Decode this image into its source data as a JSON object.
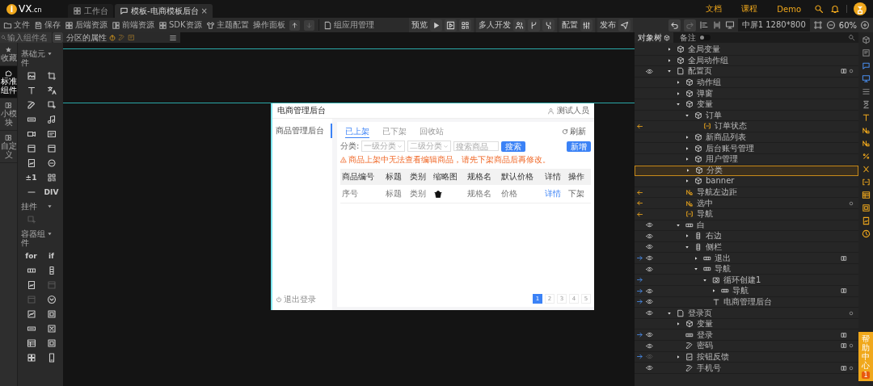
{
  "logo": {
    "badge": "i",
    "name": "VX",
    "domain": ".cn"
  },
  "tabs": [
    {
      "label": "工作台",
      "selected": false
    },
    {
      "label": "模板-电商模板后台",
      "selected": true,
      "close": "×"
    }
  ],
  "links": [
    "文档",
    "课程",
    "Demo"
  ],
  "toolbar": {
    "items": [
      "文件",
      "保存",
      "后端资源",
      "前端资源",
      "SDK资源",
      "主题配置"
    ],
    "panel": "操作面板",
    "apps": "组应用管理"
  },
  "actions": [
    {
      "label": "预览"
    },
    {
      "label": "多人开发"
    },
    {
      "label": "配置"
    },
    {
      "label": "发布"
    }
  ],
  "view": {
    "screen": "中屏1 1280*800",
    "percent": "60%"
  },
  "left": {
    "search": {
      "placeholder": "输入组件名"
    },
    "tabs": [
      {
        "label": "收藏",
        "selected": false
      },
      {
        "label": "标准组件",
        "selected": true
      },
      {
        "label": "小模块",
        "selected": false
      },
      {
        "label": "自定义",
        "selected": false
      }
    ],
    "sections": [
      {
        "title": "基础元件",
        "expanded": true,
        "items": [
          {
            "kind": "image"
          },
          {
            "kind": "crop"
          },
          {
            "kind": "text"
          },
          {
            "kind": "lang"
          },
          {
            "kind": "edit"
          },
          {
            "kind": "frame"
          },
          {
            "kind": "button"
          },
          {
            "kind": "music"
          },
          {
            "kind": "video"
          },
          {
            "kind": "screen"
          },
          {
            "kind": "window"
          },
          {
            "kind": "window"
          },
          {
            "kind": "picture"
          },
          {
            "kind": "bubble"
          },
          {
            "kind": "label",
            "label": "±1"
          },
          {
            "kind": "qr"
          },
          {
            "kind": "line"
          },
          {
            "kind": "label",
            "label": "DIV"
          }
        ]
      },
      {
        "title": "挂件",
        "expanded": true,
        "items": [
          {
            "kind": "frame",
            "disabled": true
          }
        ]
      },
      {
        "title": "容器组件",
        "expanded": true,
        "items": [
          {
            "kind": "label",
            "label": "for",
            "disabled": false
          },
          {
            "kind": "label",
            "label": "if",
            "disabled": false
          },
          {
            "kind": "row",
            "disabled": false
          },
          {
            "kind": "column",
            "disabled": false
          },
          {
            "kind": "picture",
            "disabled": false
          },
          {
            "kind": "window",
            "disabled": true
          },
          {
            "kind": "window",
            "disabled": true
          },
          {
            "kind": "down",
            "disabled": false
          },
          {
            "kind": "slider",
            "disabled": false
          },
          {
            "kind": "panel",
            "disabled": false
          },
          {
            "kind": "button",
            "disabled": false
          },
          {
            "kind": "cross",
            "disabled": false
          },
          {
            "kind": "table",
            "disabled": false
          },
          {
            "kind": "panel",
            "disabled": false
          },
          {
            "kind": "grid",
            "disabled": false
          },
          {
            "kind": "phone",
            "disabled": false
          }
        ]
      }
    ]
  },
  "canvas_panel": {
    "title": "分区的属性"
  },
  "preview": {
    "title": "电商管理后台",
    "user": "测试人员",
    "nav": [
      {
        "label": "商品管理后台",
        "selected": true
      }
    ],
    "logout": "退出登录",
    "tabs": [
      {
        "label": "已上架",
        "selected": true
      },
      {
        "label": "已下架",
        "selected": false
      },
      {
        "label": "回收站",
        "selected": false
      }
    ],
    "refresh": "刷新",
    "filter_label": "分类:",
    "selects": [
      {
        "placeholder": "一级分类"
      },
      {
        "placeholder": "二级分类"
      }
    ],
    "search": {
      "placeholder": "搜索商品"
    },
    "search_button": "搜索",
    "add_button": "新增",
    "warning": "商品上架中无法查看编辑商品，请先下架商品后再修改。",
    "columns": [
      "商品编号",
      "标题",
      "类别",
      "缩略图",
      "规格名",
      "默认价格",
      "详情",
      "操作"
    ],
    "rows": [
      {
        "id": "序号",
        "title": "标题",
        "category": "类别",
        "spec": "规格名",
        "price": "价格",
        "detail": "详情",
        "action": "下架"
      }
    ],
    "pages": [
      {
        "label": "1",
        "selected": true
      },
      {
        "label": "2",
        "selected": false
      },
      {
        "label": "3",
        "selected": false
      },
      {
        "label": "4",
        "selected": false
      },
      {
        "label": "5",
        "selected": false
      }
    ]
  },
  "tree_header": {
    "title": "对象树",
    "note": {
      "label": "备注",
      "on": false
    }
  },
  "tree": [
    {
      "label": "全局变量",
      "kind": "group",
      "expanded": false,
      "selected": false
    },
    {
      "label": "全局动作组",
      "kind": "group",
      "expanded": false,
      "selected": false
    },
    {
      "label": "配置页",
      "kind": "page",
      "expanded": true,
      "selected": false,
      "visible": true,
      "note": true,
      "dot": true,
      "children": [
        {
          "label": "动作组",
          "kind": "group",
          "expanded": false,
          "selected": false
        },
        {
          "label": "弹窗",
          "kind": "group",
          "expanded": false,
          "selected": false
        },
        {
          "label": "变量",
          "kind": "group",
          "expanded": true,
          "selected": false,
          "children": [
            {
              "label": "订单",
              "kind": "group",
              "expanded": true,
              "selected": false,
              "children": [
                {
                  "label": "订单状态",
                  "kind": "list",
                  "selected": false,
                  "bound_in": true
                }
              ]
            },
            {
              "label": "新商品列表",
              "kind": "group",
              "expanded": false,
              "selected": false
            },
            {
              "label": "后台账号管理",
              "kind": "group",
              "expanded": false,
              "selected": false
            },
            {
              "label": "用户管理",
              "kind": "group",
              "expanded": false,
              "selected": false
            },
            {
              "label": "分类",
              "kind": "group",
              "expanded": false,
              "selected": true
            },
            {
              "label": "banner",
              "kind": "group",
              "expanded": false,
              "selected": false
            }
          ]
        },
        {
          "label": "导航左边距",
          "kind": "number",
          "selected": false,
          "bound_in": true
        },
        {
          "label": "选中",
          "kind": "number",
          "selected": false,
          "bound_in": true,
          "dot": true
        },
        {
          "label": "导航",
          "kind": "list",
          "selected": false,
          "bound_in": true
        },
        {
          "label": "白",
          "kind": "row",
          "expanded": true,
          "selected": false,
          "visible": true,
          "children": [
            {
              "label": "右边",
              "kind": "column",
              "expanded": false,
              "selected": false,
              "visible": true
            },
            {
              "label": "侧栏",
              "kind": "column",
              "expanded": true,
              "selected": false,
              "visible": true,
              "children": [
                {
                  "label": "退出",
                  "kind": "row",
                  "expanded": false,
                  "selected": false,
                  "visible": true,
                  "bound_out": true,
                  "note": true
                },
                {
                  "label": "导航",
                  "kind": "row",
                  "expanded": true,
                  "selected": false,
                  "visible": true,
                  "children": [
                    {
                      "label": "循环创建1",
                      "kind": "loop",
                      "expanded": true,
                      "selected": false,
                      "bound_out": true,
                      "children": [
                        {
                          "label": "导航",
                          "kind": "row",
                          "expanded": false,
                          "selected": false,
                          "visible": true,
                          "bound_out": true,
                          "note": true
                        }
                      ]
                    },
                    {
                      "label": "电商管理后台",
                      "kind": "text",
                      "selected": false,
                      "visible": true,
                      "bound_out": true
                    }
                  ]
                }
              ]
            }
          ]
        }
      ]
    },
    {
      "label": "登录页",
      "kind": "page",
      "expanded": true,
      "selected": false,
      "visible": true,
      "dot": true,
      "children": [
        {
          "label": "变量",
          "kind": "group",
          "expanded": false,
          "selected": false
        },
        {
          "label": "登录",
          "kind": "button",
          "selected": false,
          "visible": true,
          "bound_out": true,
          "note": true
        },
        {
          "label": "密码",
          "kind": "edit",
          "selected": false,
          "visible": true,
          "note": true,
          "dot": true
        },
        {
          "label": "按钮反馈",
          "kind": "image",
          "expanded": false,
          "selected": false,
          "visible": false,
          "bound_out": true
        },
        {
          "label": "手机号",
          "kind": "edit",
          "selected": false,
          "visible": true,
          "note": true,
          "dot": true
        }
      ]
    }
  ],
  "help": {
    "label": "帮助中心",
    "badge": "1"
  }
}
